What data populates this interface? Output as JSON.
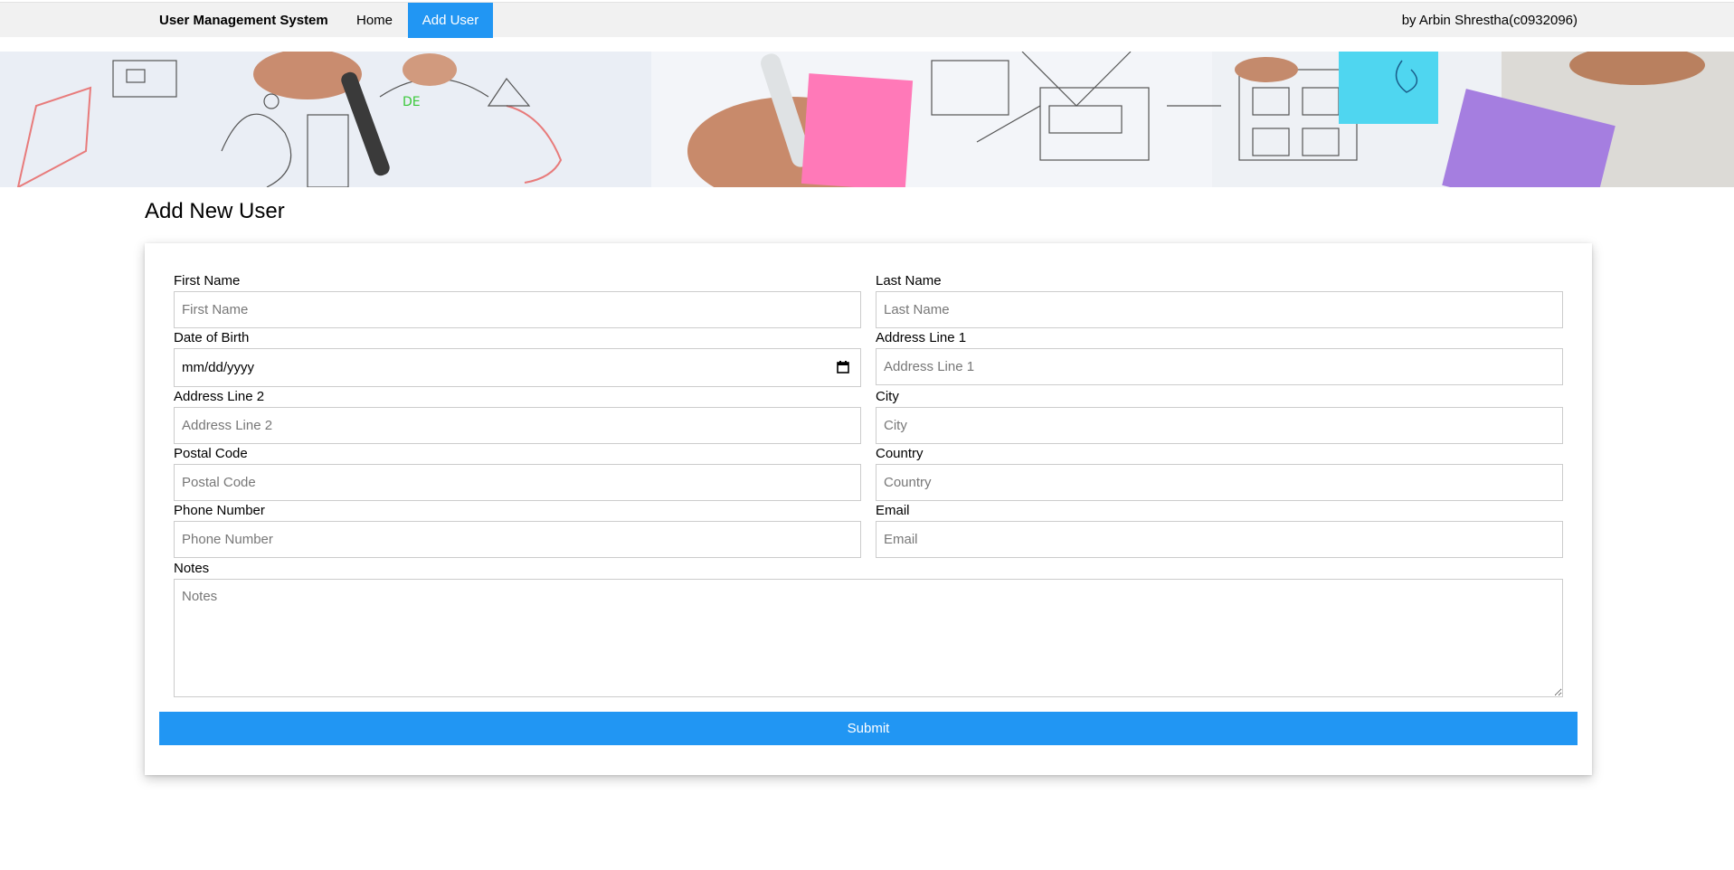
{
  "navbar": {
    "brand": "User Management System",
    "links": [
      {
        "label": "Home",
        "active": false
      },
      {
        "label": "Add User",
        "active": true
      }
    ],
    "author": "by Arbin Shrestha(c0932096)",
    "active_color": "#2196f3"
  },
  "page": {
    "title": "Add New User"
  },
  "form": {
    "first_name": {
      "label": "First Name",
      "placeholder": "First Name",
      "value": ""
    },
    "last_name": {
      "label": "Last Name",
      "placeholder": "Last Name",
      "value": ""
    },
    "dob": {
      "label": "Date of Birth",
      "display": "mm/dd/yyyy"
    },
    "address1": {
      "label": "Address Line 1",
      "placeholder": "Address Line 1",
      "value": ""
    },
    "address2": {
      "label": "Address Line 2",
      "placeholder": "Address Line 2",
      "value": ""
    },
    "city": {
      "label": "City",
      "placeholder": "City",
      "value": ""
    },
    "postal_code": {
      "label": "Postal Code",
      "placeholder": "Postal Code",
      "value": ""
    },
    "country": {
      "label": "Country",
      "placeholder": "Country",
      "value": ""
    },
    "phone": {
      "label": "Phone Number",
      "placeholder": "Phone Number",
      "value": ""
    },
    "email": {
      "label": "Email",
      "placeholder": "Email",
      "value": ""
    },
    "notes": {
      "label": "Notes",
      "placeholder": "Notes",
      "value": ""
    },
    "submit_label": "Submit"
  },
  "icons": {
    "date_picker": "calendar-icon"
  }
}
